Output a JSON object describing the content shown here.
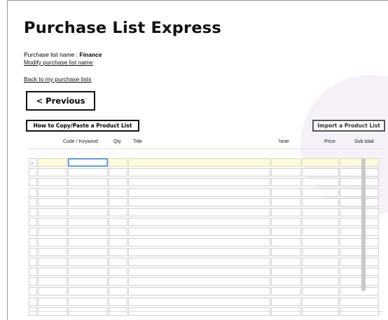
{
  "page": {
    "title": "Purchase List Express",
    "list_name_label": "Purchase list name : ",
    "list_name_value": "Finance",
    "modify_link": "Modify purchase list name",
    "back_link": "Back to my purchase lists"
  },
  "buttons": {
    "previous": "< Previous",
    "how_to": "How to Copy/Paste a Product List",
    "import": "Import a Product List"
  },
  "grid": {
    "columns": [
      "Code / Keyword",
      "Qty",
      "Title",
      "Note",
      "Price",
      "Sub total"
    ],
    "row_indicator": "▹",
    "row_count": 16
  },
  "colors": {
    "selected_row": "#fdfbdc",
    "focus_border": "#3a7bd5"
  }
}
